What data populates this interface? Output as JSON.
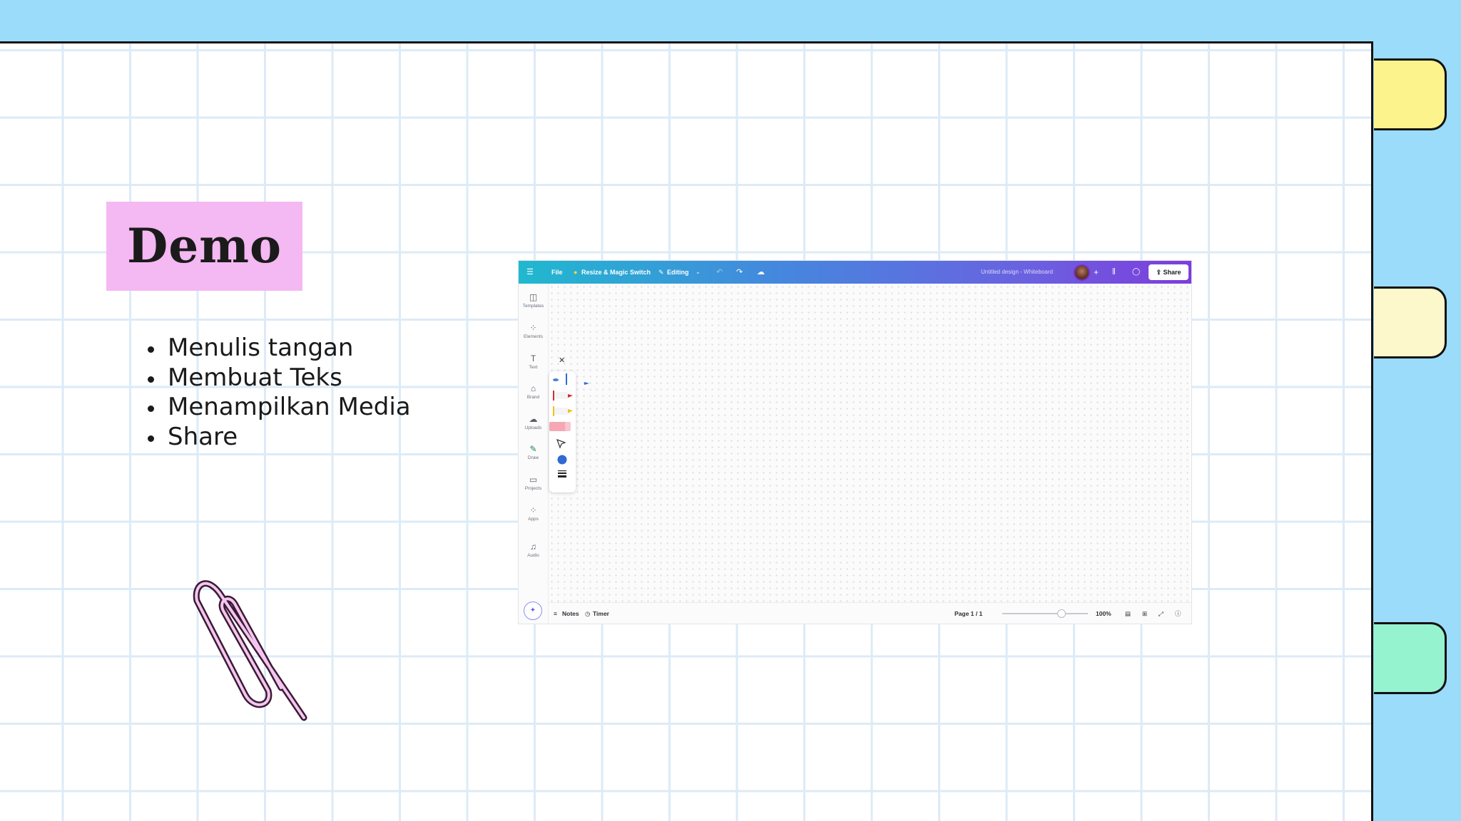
{
  "slide": {
    "title": "Demo",
    "bullets": [
      "Menulis tangan",
      "Membuat Teks",
      "Menampilkan Media",
      "Share"
    ],
    "colors": {
      "background": "#9bdcfb",
      "title_highlight": "#f4b8f2",
      "tab_yellow": "#fdf38d",
      "tab_cream": "#fdf7cc",
      "tab_green": "#96f3cf"
    }
  },
  "canva": {
    "topbar": {
      "menu_icon": "menu-icon",
      "file": "File",
      "resize": "Resize & Magic Switch",
      "editing": "Editing",
      "doc_title": "Untitled design - Whiteboard",
      "share": "Share"
    },
    "sidebar": [
      {
        "label": "Templates",
        "icon": "templates-icon"
      },
      {
        "label": "Elements",
        "icon": "elements-icon"
      },
      {
        "label": "Text",
        "icon": "text-icon"
      },
      {
        "label": "Brand",
        "icon": "brand-icon"
      },
      {
        "label": "Uploads",
        "icon": "uploads-icon"
      },
      {
        "label": "Draw",
        "icon": "draw-icon"
      },
      {
        "label": "Projects",
        "icon": "projects-icon"
      },
      {
        "label": "Apps",
        "icon": "apps-icon"
      },
      {
        "label": "Audio",
        "icon": "audio-icon"
      }
    ],
    "bottombar": {
      "notes": "Notes",
      "timer": "Timer",
      "page": "Page 1 / 1",
      "zoom": "100%"
    }
  }
}
